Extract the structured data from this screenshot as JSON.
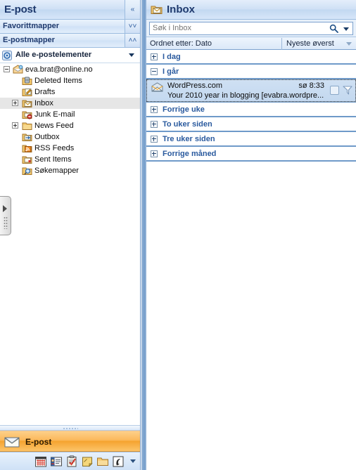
{
  "nav_pane": {
    "title": "E-post",
    "collapse_icon": "«",
    "sections": [
      {
        "label": "Favorittmapper",
        "chevron": "˅˅"
      },
      {
        "label": "E-postmapper",
        "chevron": "˄˄"
      }
    ],
    "scope": {
      "label": "Alle e-postelementer",
      "icon": "mail-scope-icon"
    },
    "tree": [
      {
        "label": "eva.brat@online.no",
        "level": 0,
        "expander": "minus",
        "icon": "mailbox-icon",
        "selected": false
      },
      {
        "label": "Deleted Items",
        "level": 1,
        "expander": "none",
        "icon": "trash-folder-icon",
        "selected": false
      },
      {
        "label": "Drafts",
        "level": 1,
        "expander": "none",
        "icon": "drafts-folder-icon",
        "selected": false
      },
      {
        "label": "Inbox",
        "level": 1,
        "expander": "plus",
        "icon": "inbox-folder-icon",
        "selected": true
      },
      {
        "label": "Junk E-mail",
        "level": 1,
        "expander": "none",
        "icon": "junk-folder-icon",
        "selected": false
      },
      {
        "label": "News Feed",
        "level": 1,
        "expander": "plus",
        "icon": "plain-folder-icon",
        "selected": false
      },
      {
        "label": "Outbox",
        "level": 1,
        "expander": "none",
        "icon": "outbox-folder-icon",
        "selected": false
      },
      {
        "label": "RSS Feeds",
        "level": 1,
        "expander": "none",
        "icon": "rss-folder-icon",
        "selected": false
      },
      {
        "label": "Sent Items",
        "level": 1,
        "expander": "none",
        "icon": "sent-folder-icon",
        "selected": false
      },
      {
        "label": "Søkemapper",
        "level": 1,
        "expander": "none",
        "icon": "search-folder-icon",
        "selected": false
      }
    ],
    "module_button": {
      "label": "E-post",
      "icon": "mail-module-icon"
    },
    "module_icons": [
      "calendar-module-icon",
      "contacts-module-icon",
      "tasks-module-icon",
      "notes-module-icon",
      "folder-list-module-icon",
      "shortcuts-module-icon"
    ],
    "expander_tab": {
      "icon": "expand-right-icon"
    }
  },
  "list_pane": {
    "header": {
      "title": "Inbox",
      "icon": "inbox-folder-icon"
    },
    "search": {
      "placeholder": "Søk i Inbox",
      "value": "",
      "icon": "search-icon"
    },
    "sort": {
      "left_label": "Ordnet etter: Dato",
      "right_label": "Nyeste øverst"
    },
    "groups": [
      {
        "label": "I dag",
        "state": "collapsed"
      },
      {
        "label": "I går",
        "state": "expanded"
      },
      {
        "label": "Forrige uke",
        "state": "collapsed"
      },
      {
        "label": "To uker siden",
        "state": "collapsed"
      },
      {
        "label": "Tre uker siden",
        "state": "collapsed"
      },
      {
        "label": "Forrige måned",
        "state": "collapsed"
      }
    ],
    "messages": [
      {
        "sender": "WordPress.com",
        "received": "sø 8:33",
        "subject": "Your 2010 year in blogging [evabra.wordpre...",
        "selected": true,
        "icon": "open-envelope-icon"
      }
    ]
  },
  "colors": {
    "accent_blue": "#2a5a9e",
    "title_blue": "#1f3a6e",
    "module_orange": "#f5a32f",
    "selection_blue": "#c3d8ef",
    "tree_selected_gray": "#e6e6e6",
    "divider_blue": "#6f9ac9"
  }
}
